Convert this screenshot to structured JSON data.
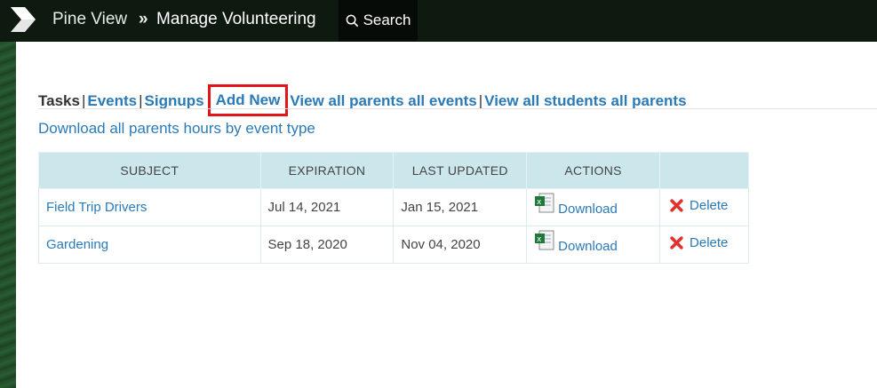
{
  "header": {
    "home": "Pine View",
    "separator": "»",
    "current": "Manage Volunteering",
    "search_label": "Search",
    "logo_icon": "chevron-logo-icon",
    "search_icon": "search-icon"
  },
  "nav": {
    "tasks": "Tasks",
    "events": "Events",
    "signups": "Signups",
    "add_new": "Add New",
    "view_parents": "View all parents all events",
    "view_students": "View all students all parents",
    "pipe": "|"
  },
  "download_all": "Download all parents hours by event type",
  "table": {
    "headers": [
      "SUBJECT",
      "EXPIRATION",
      "LAST UPDATED",
      "ACTIONS",
      ""
    ],
    "rows": [
      {
        "subject": "Field Trip Drivers",
        "expiration": "Jul 14, 2021",
        "last_updated": "Jan 15, 2021",
        "download": "Download",
        "delete": "Delete"
      },
      {
        "subject": "Gardening",
        "expiration": "Sep 18, 2020",
        "last_updated": "Nov 04, 2020",
        "download": "Download",
        "delete": "Delete"
      }
    ]
  },
  "colors": {
    "topbar": "#0e1a10",
    "link": "#2a7ab8",
    "highlight": "#e2141b",
    "table_header": "#cbe7ec"
  }
}
